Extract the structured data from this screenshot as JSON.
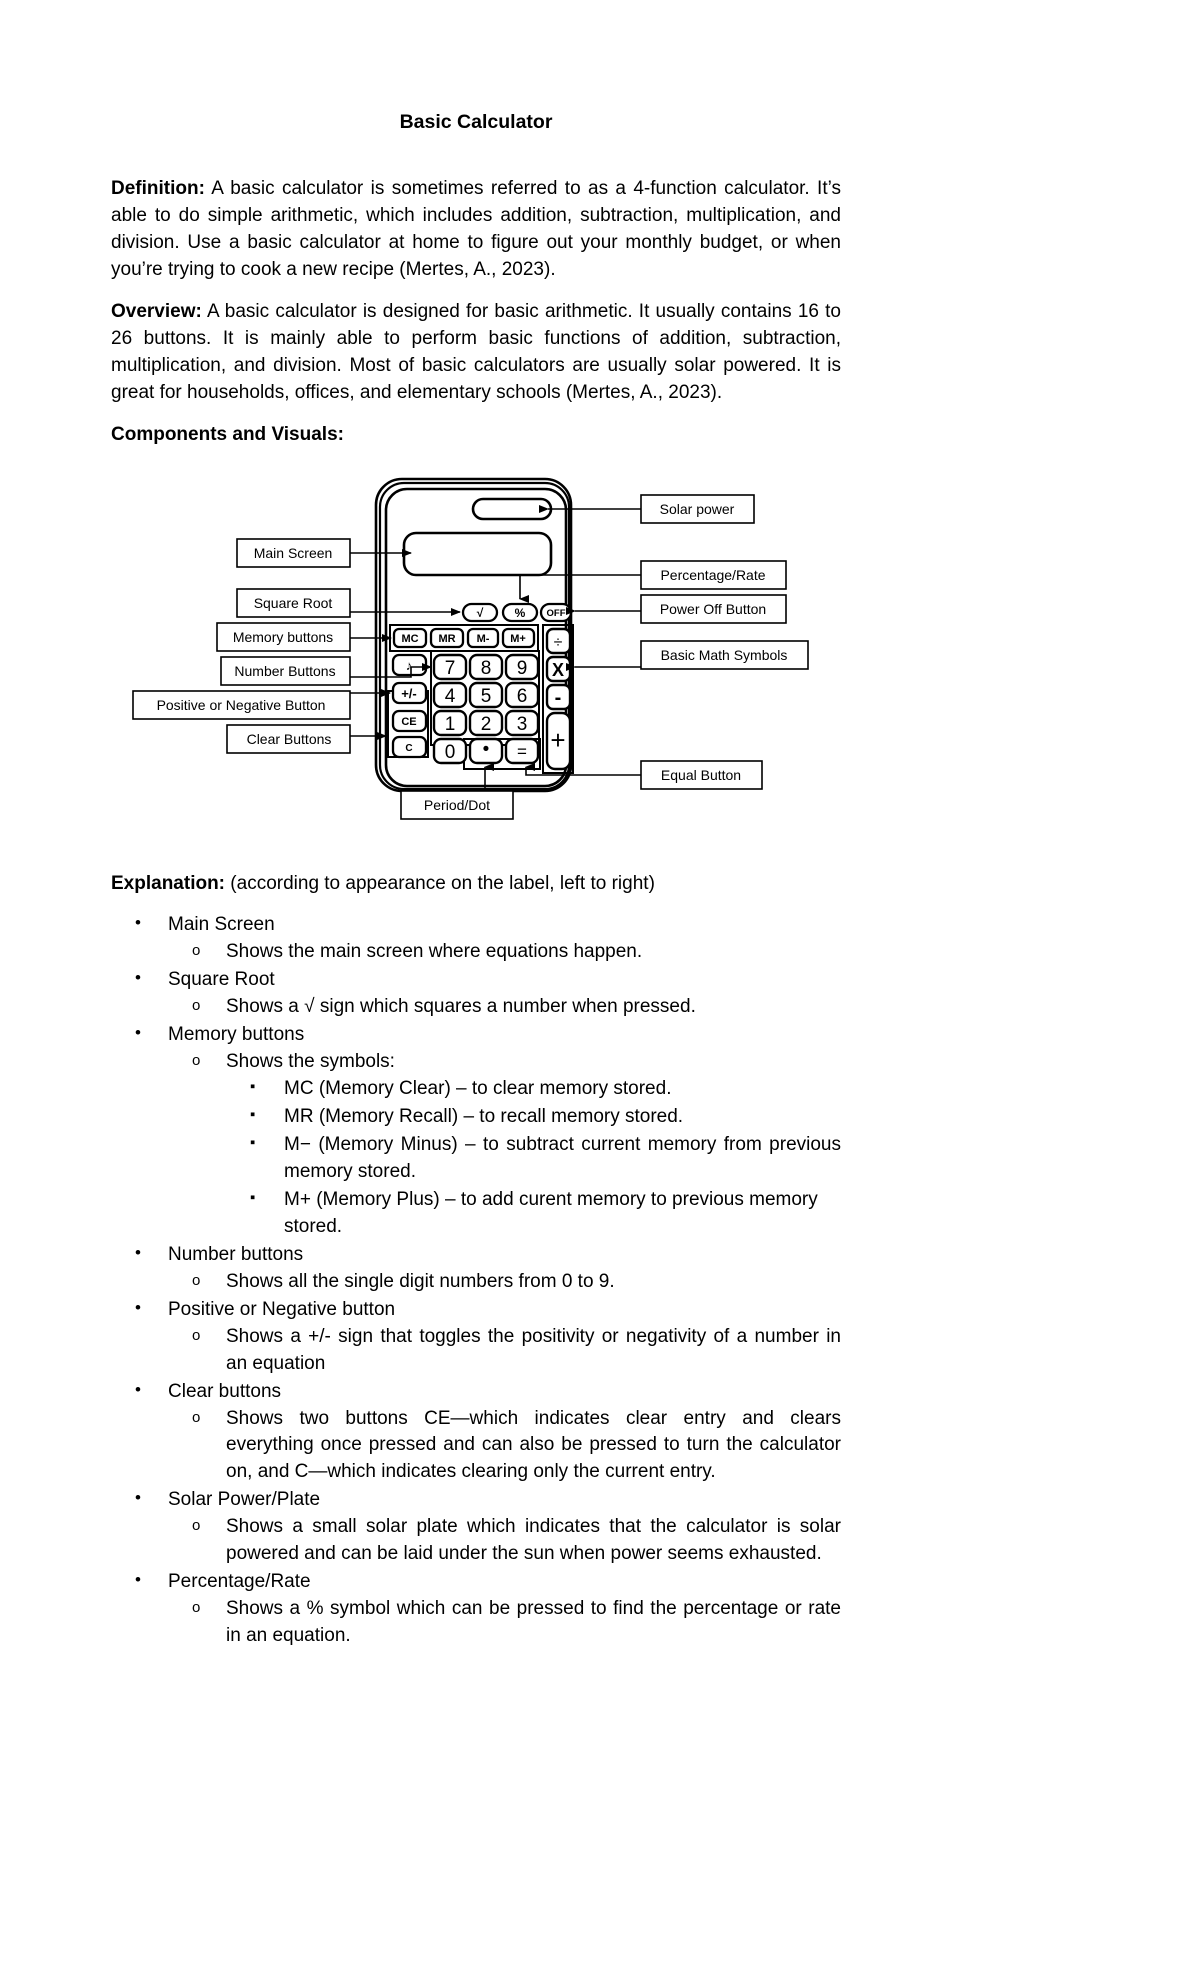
{
  "document": {
    "title": "Basic Calculator",
    "paragraphs": [
      {
        "label": "Definition:",
        "body": " A basic calculator is sometimes referred to as a 4-function calculator. It’s able to do simple arithmetic, which includes addition, subtraction, multiplication, and division. Use a basic calculator at home to figure out your monthly budget, or when you’re trying to cook a new recipe (Mertes, A., 2023)."
      },
      {
        "label": "Overview:",
        "body": " A basic calculator is designed for basic arithmetic. It usually contains 16 to 26 buttons. It is mainly able to perform basic functions of addition, subtraction, multiplication, and division. Most of basic calculators are usually solar powered. It is great for households, offices, and elementary schools (Mertes, A., 2023)."
      }
    ],
    "components_heading": "Components and Visuals:",
    "explanation": {
      "label": "Explanation:",
      "note": " (according to appearance on the label, left to right)"
    }
  },
  "figure": {
    "callouts_left": [
      {
        "id": "main-screen",
        "label": "Main Screen"
      },
      {
        "id": "square-root",
        "label": "Square Root"
      },
      {
        "id": "memory-buttons",
        "label": "Memory buttons"
      },
      {
        "id": "number-buttons",
        "label": "Number Buttons"
      },
      {
        "id": "positive-negative",
        "label": "Positive or Negative Button"
      },
      {
        "id": "clear-buttons",
        "label": "Clear Buttons"
      }
    ],
    "callouts_right": [
      {
        "id": "solar-power",
        "label": "Solar power"
      },
      {
        "id": "percentage-rate",
        "label": "Percentage/Rate"
      },
      {
        "id": "power-off",
        "label": "Power Off Button"
      },
      {
        "id": "basic-math",
        "label": "Basic Math Symbols"
      },
      {
        "id": "equal-button",
        "label": "Equal Button"
      }
    ],
    "callouts_bottom": [
      {
        "id": "period-dot",
        "label": "Period/Dot"
      }
    ],
    "calculator": {
      "top_row": [
        "√",
        "%",
        "OFF"
      ],
      "memory_row": [
        "MC",
        "MR",
        "M-",
        "M+"
      ],
      "left_column": [
        "♪",
        "+/-",
        "CE",
        "C"
      ],
      "digit_rows": [
        [
          "7",
          "8",
          "9"
        ],
        [
          "4",
          "5",
          "6"
        ],
        [
          "1",
          "2",
          "3"
        ]
      ],
      "bottom_row": [
        "0",
        "•",
        "="
      ],
      "operator_column": [
        "÷",
        "X",
        "-",
        "+"
      ]
    }
  },
  "explanation_items": [
    {
      "title": "Main Screen",
      "subs": [
        {
          "text": "Shows the main screen where equations happen."
        }
      ]
    },
    {
      "title": "Square Root",
      "subs": [
        {
          "text": "Shows a √ sign which squares a number when pressed."
        }
      ]
    },
    {
      "title": "Memory buttons",
      "subs": [
        {
          "text": "Shows the symbols:",
          "subsubs": [
            "MC (Memory Clear) – to clear memory stored.",
            "MR (Memory Recall) – to recall memory stored.",
            "M− (Memory Minus) – to subtract current memory from previous memory stored.",
            "M+ (Memory Plus) – to add curent memory to previous memory stored."
          ]
        }
      ]
    },
    {
      "title": "Number buttons",
      "subs": [
        {
          "text": "Shows all the single digit numbers from 0 to 9."
        }
      ]
    },
    {
      "title": "Positive or Negative button",
      "subs": [
        {
          "text": "Shows a +/- sign that toggles the positivity or negativity of a number in an equation"
        }
      ]
    },
    {
      "title": "Clear buttons",
      "subs": [
        {
          "text": "Shows two buttons CE—which indicates clear entry and clears everything once pressed and can also be pressed to turn the calculator on, and C—which indicates clearing only the current entry."
        }
      ]
    },
    {
      "title": "Solar Power/Plate",
      "subs": [
        {
          "text": "Shows a small solar plate which indicates that the calculator is solar powered and can be laid under the sun when power seems exhausted."
        }
      ]
    },
    {
      "title": "Percentage/Rate",
      "subs": [
        {
          "text": "Shows a % symbol which can be pressed to find the percentage or rate in an equation."
        }
      ]
    }
  ]
}
